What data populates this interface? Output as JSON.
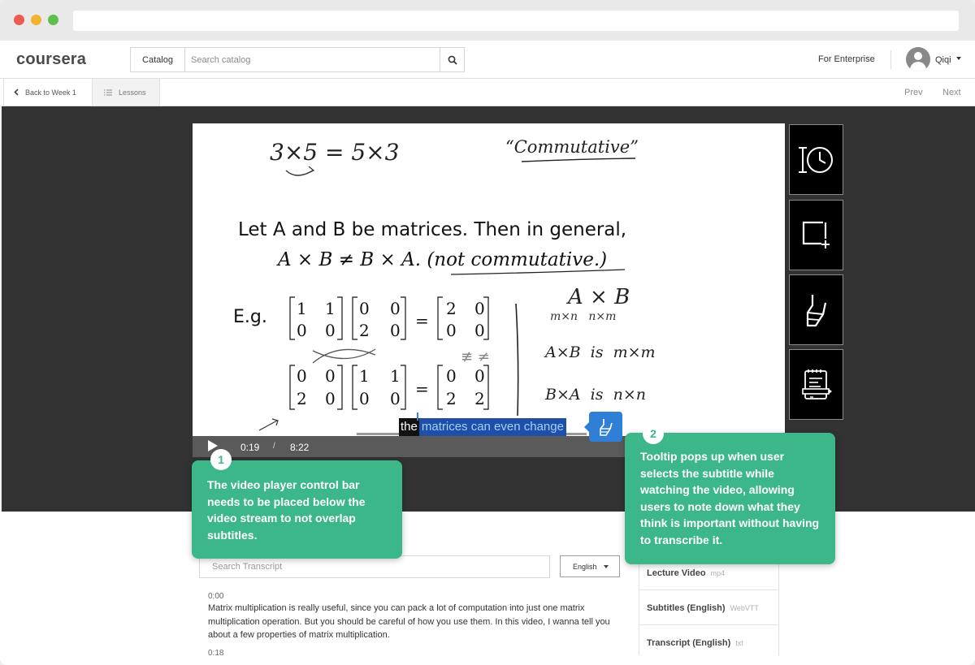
{
  "browser": {
    "address": ""
  },
  "header": {
    "logo": "coursera",
    "catalog_label": "Catalog",
    "search_placeholder": "Search catalog",
    "enterprise_label": "For Enterprise",
    "username": "Qiqi"
  },
  "subnav": {
    "back_label": "Back to Week 1",
    "lessons_label": "Lessons",
    "prev_label": "Prev",
    "next_label": "Next"
  },
  "player": {
    "current_time": "0:19",
    "separator": "/",
    "total_time": "8:22",
    "progress_fraction": 0.038,
    "subtitle_plain": "the",
    "subtitle_selected": "matrices can even change"
  },
  "board": {
    "line1": "Let A and B be matrices. Then in general,",
    "line2": "A × B ≠ B × A. (not commutative.)",
    "eg_label": "E.g.",
    "handwriting_top_left": "3×5 = 5×3",
    "handwriting_top_right": "“Commutative”",
    "handwriting_right": [
      "A × B",
      "m×n   n×m",
      "A×B  is  m×m",
      "B×A  is  n×n"
    ]
  },
  "tools": [
    {
      "name": "bookmark-time-icon"
    },
    {
      "name": "capture-frame-icon"
    },
    {
      "name": "highlighter-icon"
    },
    {
      "name": "notes-icon"
    }
  ],
  "callouts": [
    {
      "number": "1",
      "text": "The video player control bar needs to be placed below the video stream to not overlap subtitles."
    },
    {
      "number": "2",
      "text": "Tooltip pops up when user selects the subtitle while watching the video, allowing users to note down what they think is important without having to transcribe it."
    }
  ],
  "transcript": {
    "search_placeholder": "Search Transcript",
    "language": "English",
    "entries": [
      {
        "time": "0:00",
        "text": "Matrix multiplication is really useful, since you can pack a lot of computation into just one matrix multiplication operation. But you should be careful of how you use them. In this video, I wanna tell you about a few properties of matrix multiplication."
      },
      {
        "time": "0:18",
        "text": ""
      }
    ]
  },
  "downloads": [
    {
      "label": "Lecture Video",
      "ext": "mp4"
    },
    {
      "label": "Subtitles (English)",
      "ext": "WebVTT"
    },
    {
      "label": "Transcript (English)",
      "ext": "txt"
    }
  ],
  "colors": {
    "accent_green": "#3cb78a",
    "highlight_blue": "#2f7fd6",
    "stage_bg": "#323232"
  }
}
